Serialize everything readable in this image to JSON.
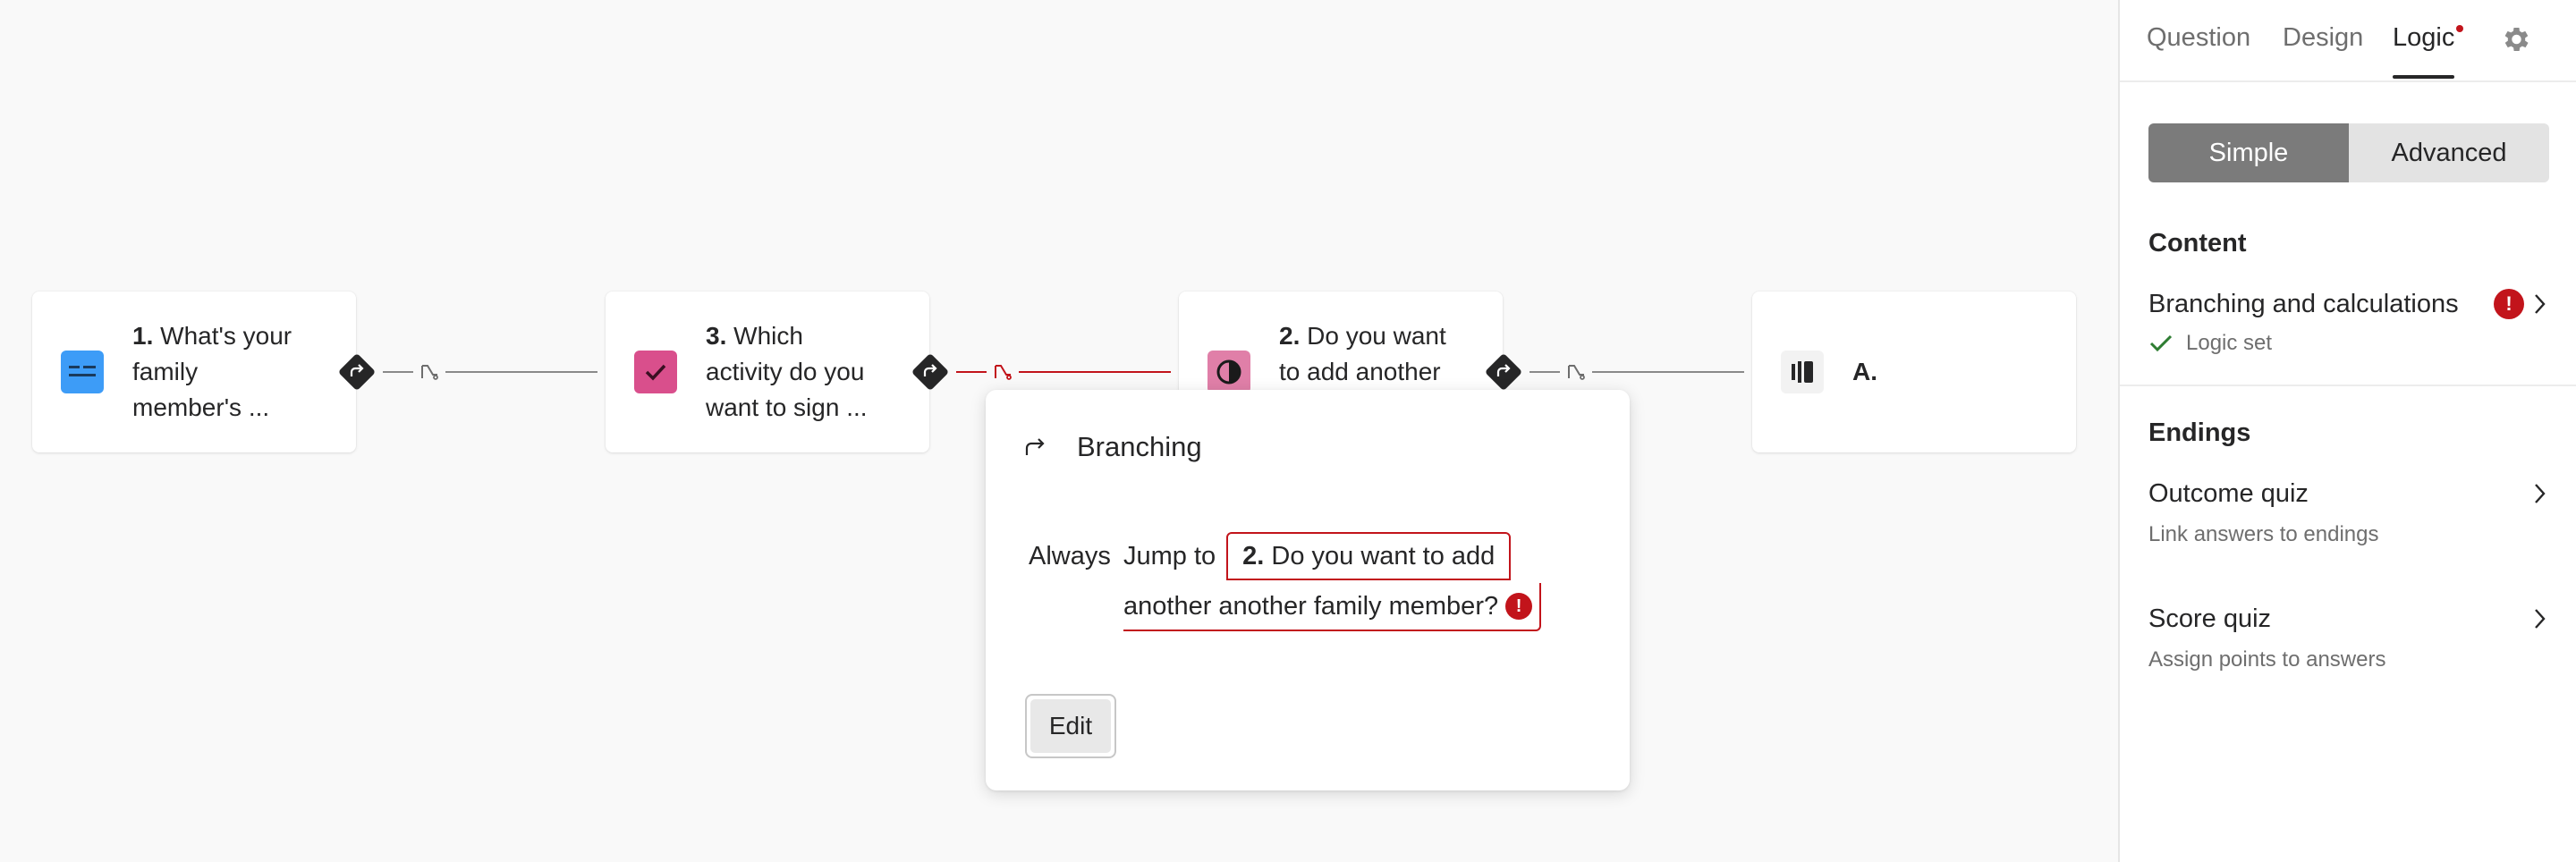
{
  "flow": {
    "nodes": [
      {
        "number": "1.",
        "text": "What's your family member's ...",
        "lines": [
          "What's your",
          "family",
          "member's ..."
        ],
        "icon": "short-text-icon",
        "icon_color": "#3d9cf7"
      },
      {
        "number": "3.",
        "text": "Which activity do you want to sign ...",
        "lines": [
          "Which",
          "activity do you",
          "want to sign ..."
        ],
        "icon": "checkbox-icon",
        "icon_color": "#d94f8c"
      },
      {
        "number": "2.",
        "text": "Do you want to add another",
        "lines": [
          "Do you want",
          "to add another"
        ],
        "icon": "yes-no-icon",
        "icon_color": "#e07fa8"
      },
      {
        "number": "A.",
        "text": "",
        "icon": "ending-icon",
        "icon_color": "#f2f2f2"
      }
    ],
    "connector_error_color": "#c2141b"
  },
  "popup": {
    "title": "Branching",
    "always": "Always",
    "jump_to": "Jump to",
    "target_number": "2.",
    "target_line1": "Do you want to add",
    "target_line2": "another another family member?",
    "error_badge": "!",
    "edit_button": "Edit"
  },
  "panel": {
    "tabs": [
      "Question",
      "Design",
      "Logic"
    ],
    "active_tab": "Logic",
    "mode": {
      "simple": "Simple",
      "advanced": "Advanced",
      "selected": "Simple"
    },
    "content_title": "Content",
    "branching": {
      "title": "Branching and calculations",
      "error_badge": "!",
      "status": "Logic set"
    },
    "endings_title": "Endings",
    "outcome": {
      "title": "Outcome quiz",
      "subtitle": "Link answers to endings"
    },
    "score": {
      "title": "Score quiz",
      "subtitle": "Assign points to answers"
    }
  },
  "colors": {
    "accent_dark": "#262627",
    "error": "#c2141b",
    "success": "#2e7d32"
  }
}
